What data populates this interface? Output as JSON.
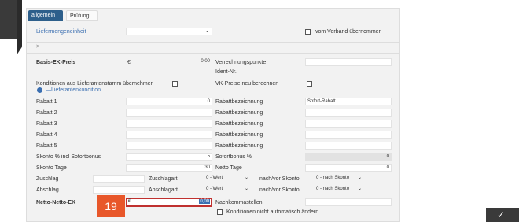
{
  "tabs": [
    "allgemein",
    "Prüfung"
  ],
  "liefermenge": {
    "label": "Liefermengeneinheit",
    "verband_label": "vom Verband übernommen"
  },
  "chevron": ">",
  "basis": {
    "label": "Basis-EK-Preis",
    "currency": "€",
    "value": "0,00",
    "verrechnung_label": "Verrechnungspunkte",
    "ident_label": "Ident-Nr."
  },
  "konditionen": {
    "label": "Konditionen aus Lieferantenstamm übernehmen",
    "radio_label": "—Lieferantenkondition",
    "vk_label": "VK-Preise neu berechnen"
  },
  "rabatte": [
    {
      "label": "Rabatt 1",
      "value": "0",
      "bez_label": "Rabattbezeichnung",
      "bez_value": "Sofort-Rabatt"
    },
    {
      "label": "Rabatt 2",
      "value": "",
      "bez_label": "Rabattbezeichnung",
      "bez_value": ""
    },
    {
      "label": "Rabatt 3",
      "value": "",
      "bez_label": "Rabattbezeichnung",
      "bez_value": ""
    },
    {
      "label": "Rabatt 4",
      "value": "",
      "bez_label": "Rabattbezeichnung",
      "bez_value": ""
    },
    {
      "label": "Rabatt 5",
      "value": "",
      "bez_label": "Rabattbezeichnung",
      "bez_value": ""
    }
  ],
  "skonto": {
    "label": "Skonto % incl Sofortbonus",
    "value": "5",
    "sofort_label": "Sofortbonus %",
    "sofort_value": "0"
  },
  "skonto_tage": {
    "label": "Skonto Tage",
    "value": "30",
    "netto_label": "Netto Tage",
    "netto_value": "0"
  },
  "zuschlag": {
    "label": "Zuschlag",
    "art_label": "Zuschlagart",
    "art_value": "0 - Wert",
    "skonto_label": "nach/vor Skonto",
    "skonto_value": "0 - nach Skonto"
  },
  "abschlag": {
    "label": "Abschlag",
    "art_label": "Abschlagart",
    "art_value": "0 - Wert",
    "skonto_label": "nach/vor Skonto",
    "skonto_value": "0 - nach Skonto"
  },
  "netto": {
    "label": "Netto-Netto-EK",
    "currency": "€",
    "value": "0,00",
    "nachkomma_label": "Nachkommastellen",
    "nicht_label": "Konditionen nicht automatisch ändern"
  },
  "step_badge": "19",
  "corner_glyph": "✓"
}
